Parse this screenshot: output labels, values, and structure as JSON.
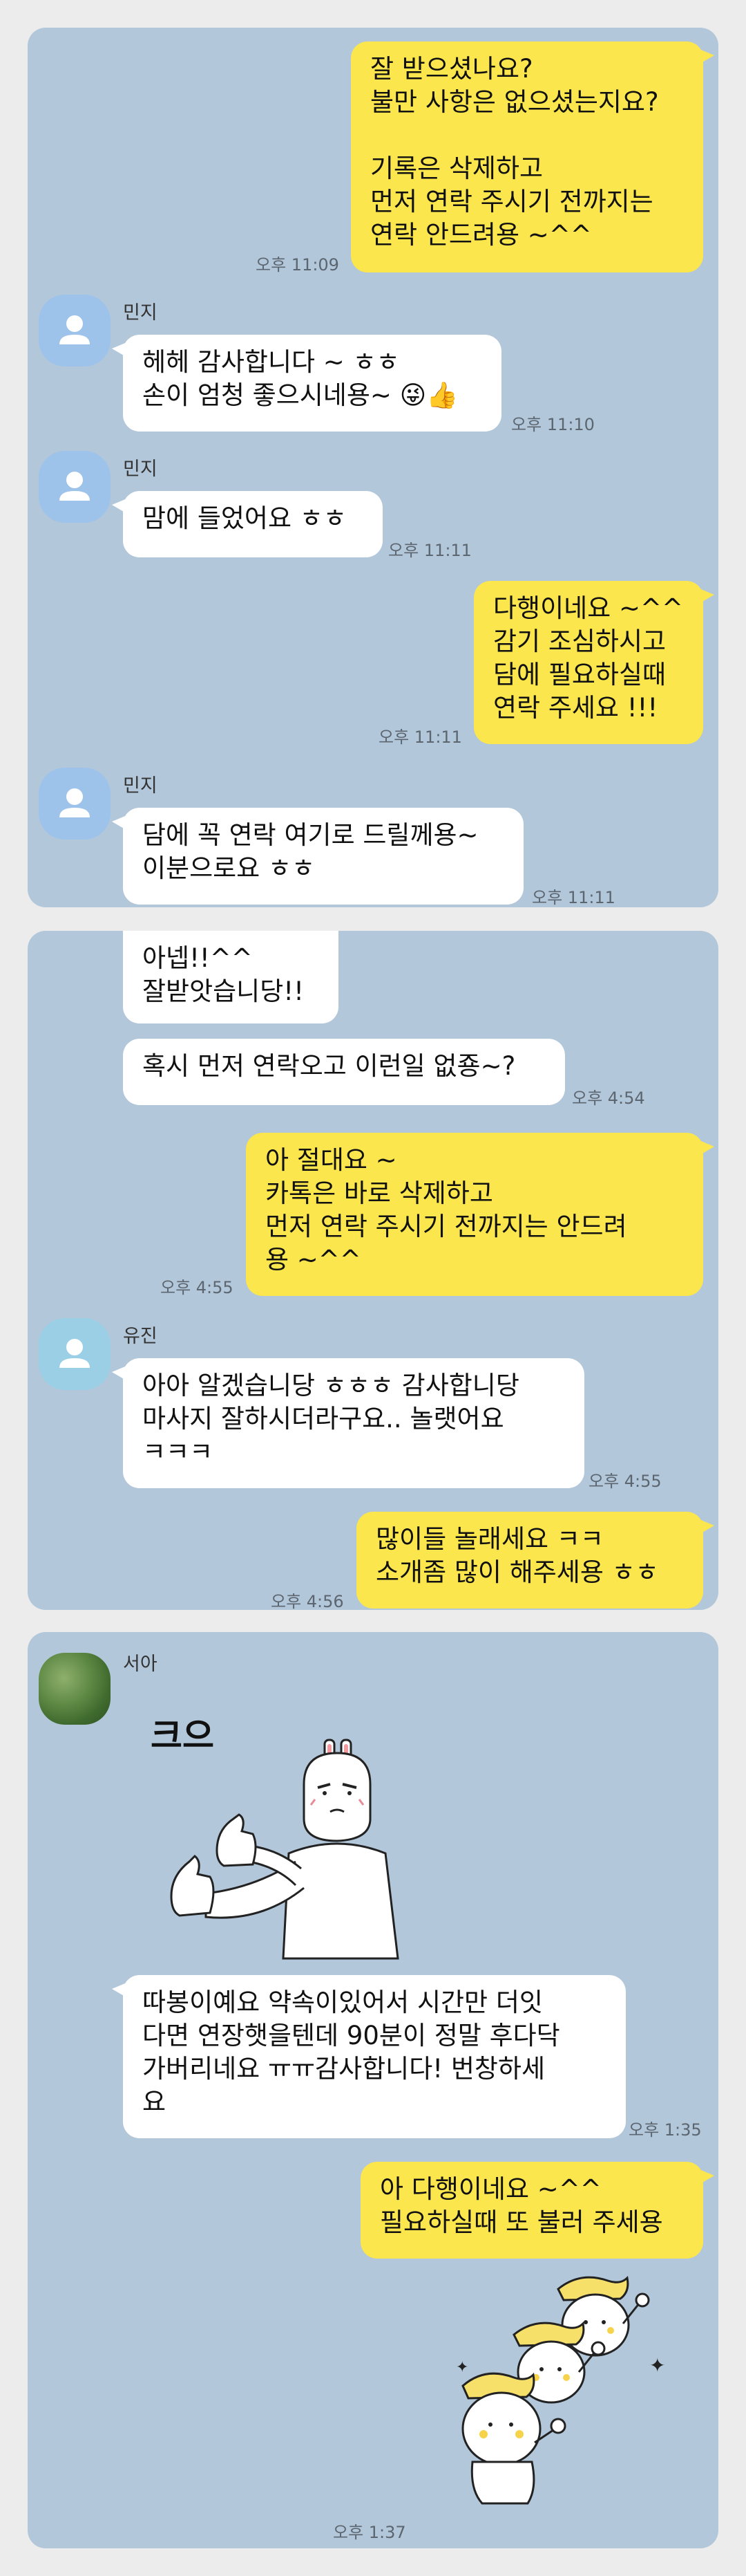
{
  "colors": {
    "page_bg": "#ececec",
    "chat_bg": "#b3c7da",
    "my_bubble": "#fbe64d",
    "their_bubble": "#ffffff",
    "avatar_default": "#9ec3ea"
  },
  "panel1": {
    "m1": {
      "text": "잘 받으셨나요?\n불만 사항은 없으셨는지요?\n\n기록은 삭제하고\n먼저 연락 주시기 전까지는\n연락 안드려용 ~^^",
      "time": "오후 11:09"
    },
    "m2": {
      "name": "민지",
      "text": "헤헤 감사합니다 ~ ㅎㅎ\n손이 엄청 좋으시네용~ 😜👍",
      "time": "오후 11:10"
    },
    "m3": {
      "name": "민지",
      "text": "맘에 들었어요 ㅎㅎ",
      "time": "오후 11:11"
    },
    "m4": {
      "text": "다행이네요 ~^^\n감기 조심하시고\n담에 필요하실때\n연락 주세요 !!!",
      "time": "오후 11:11"
    },
    "m5": {
      "name": "민지",
      "text": "담에 꼭 연락 여기로 드릴께용~\n이분으로요 ㅎㅎ",
      "time": "오후 11:11"
    }
  },
  "panel2": {
    "m1": {
      "text": "아넵!!^^\n잘받앗습니당!!"
    },
    "m2": {
      "text": "혹시 먼저 연락오고 이런일 없죵~?",
      "time": "오후 4:54"
    },
    "m3": {
      "text": "아 절대요 ~\n카톡은 바로 삭제하고\n먼저 연락 주시기 전까지는 안드려\n용 ~^^",
      "time": "오후 4:55"
    },
    "m4": {
      "name": "유진",
      "text": "아아 알겠습니당 ㅎㅎㅎ 감사합니당\n마사지 잘하시더라구요.. 놀랫어요\nㅋㅋㅋ",
      "time": "오후 4:55"
    },
    "m5": {
      "text": "많이들 놀래세요 ㅋㅋ\n소개좀 많이 해주세용 ㅎㅎ",
      "time": "오후 4:56"
    }
  },
  "panel3": {
    "sender": {
      "name": "서아"
    },
    "sticker1": {
      "text": "크으",
      "icon": "thumbs-up-character-sticker"
    },
    "m1": {
      "text": "따봉이예요 약속이있어서 시간만 더잇\n다면 연장햇을텐데 90분이 정말 후다닥\n가버리네요 ㅠㅠ감사합니다! 번창하세\n요",
      "time": "오후 1:35"
    },
    "m2": {
      "text": "아 다행이네요 ~^^\n필요하실때 또 불러 주세용"
    },
    "sticker2": {
      "icon": "three-cheering-characters-sticker",
      "time": "오후 1:37"
    }
  }
}
